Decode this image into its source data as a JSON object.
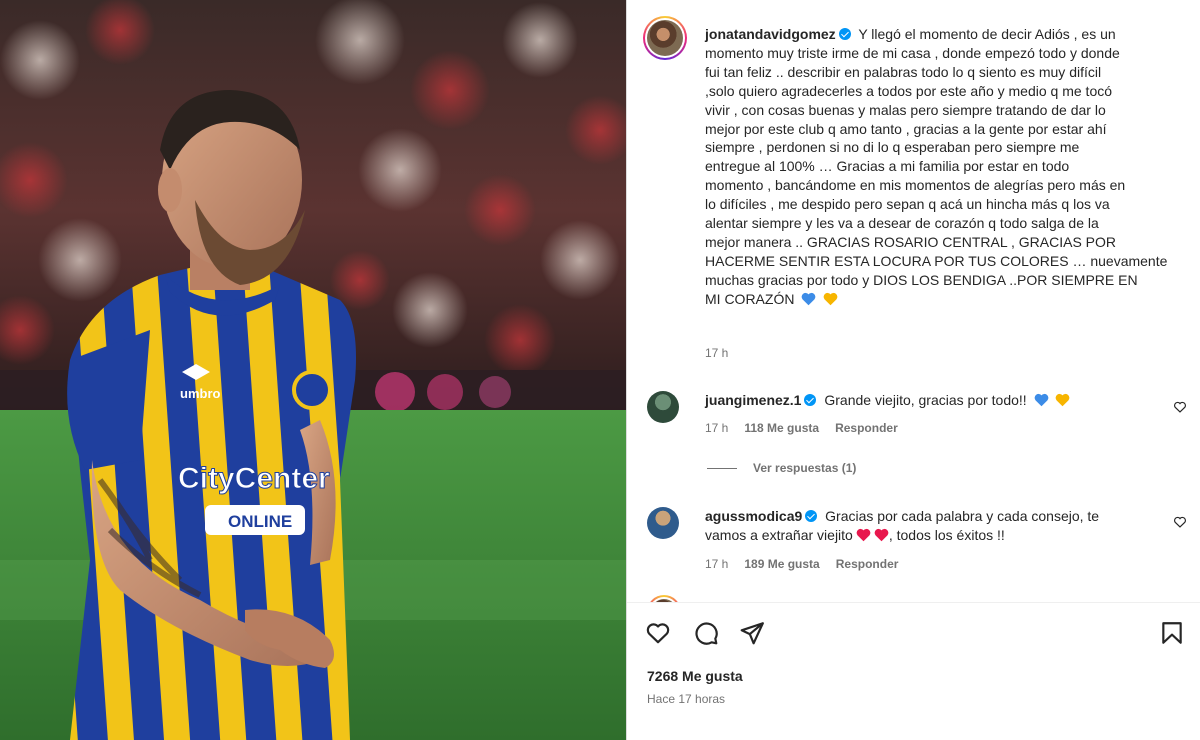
{
  "post": {
    "author": "jonatandavidgomez",
    "caption_lines": [
      "Y llegó el momento de decir Adiós , es un",
      "momento muy triste irme de mi casa , donde empezó todo y donde",
      "fui tan feliz .. describir en palabras todo lo q siento es muy difícil",
      ",solo quiero agradecerles a todos por este año y medio q me tocó",
      "vivir , con cosas buenas y malas pero siempre tratando de dar lo",
      "mejor por este club q amo tanto , gracias a la gente por estar ahí",
      "siempre , perdonen si no di lo q esperaban pero siempre me",
      "entregue al 100% … Gracias a mi familia por estar en todo",
      "momento , bancándome en mis momentos de alegrías pero más en",
      "lo difíciles , me despido pero sepan q acá un hincha más q los va",
      "alentar siempre y les va a desear de corazón q todo salga de la",
      "mejor manera .. GRACIAS ROSARIO CENTRAL , GRACIAS POR",
      "HACERME SENTIR ESTA LOCURA POR TUS COLORES … nuevamente",
      "muchas gracias por todo y DIOS LOS BENDIGA ..POR SIEMPRE EN",
      "MI CORAZÓN"
    ],
    "caption_time": "17 h",
    "likes": "7268 Me gusta",
    "time_ago": "Hace 17 horas",
    "heart_colors": {
      "blue": "#3c8ce7",
      "yellow": "#f7b500",
      "red": "#e8174d"
    }
  },
  "comments": [
    {
      "username": "juangimenez.1",
      "text": "Grande viejito, gracias por todo!!",
      "time": "17 h",
      "likes": "118 Me gusta",
      "reply": "Responder",
      "view_replies": "Ver respuestas (1)"
    },
    {
      "username": "agussmodica9",
      "text_line1": "Gracias por cada palabra y cada consejo, te",
      "text_line2": "vamos a extrañar viejito",
      "text_line2_end": ", todos los éxitos !!",
      "time": "17 h",
      "likes": "189 Me gusta",
      "reply": "Responder"
    }
  ],
  "photo": {
    "jersey_sponsor": "CityCenter",
    "jersey_sub": "ONLINE",
    "jersey_brand": "umbro",
    "colors": {
      "blue": "#1f3f9e",
      "yellow": "#f2c418",
      "pitch": "#3f8a3a"
    }
  },
  "icons": [
    "heart-icon",
    "comment-icon",
    "share-icon",
    "bookmark-icon",
    "verified-icon"
  ]
}
